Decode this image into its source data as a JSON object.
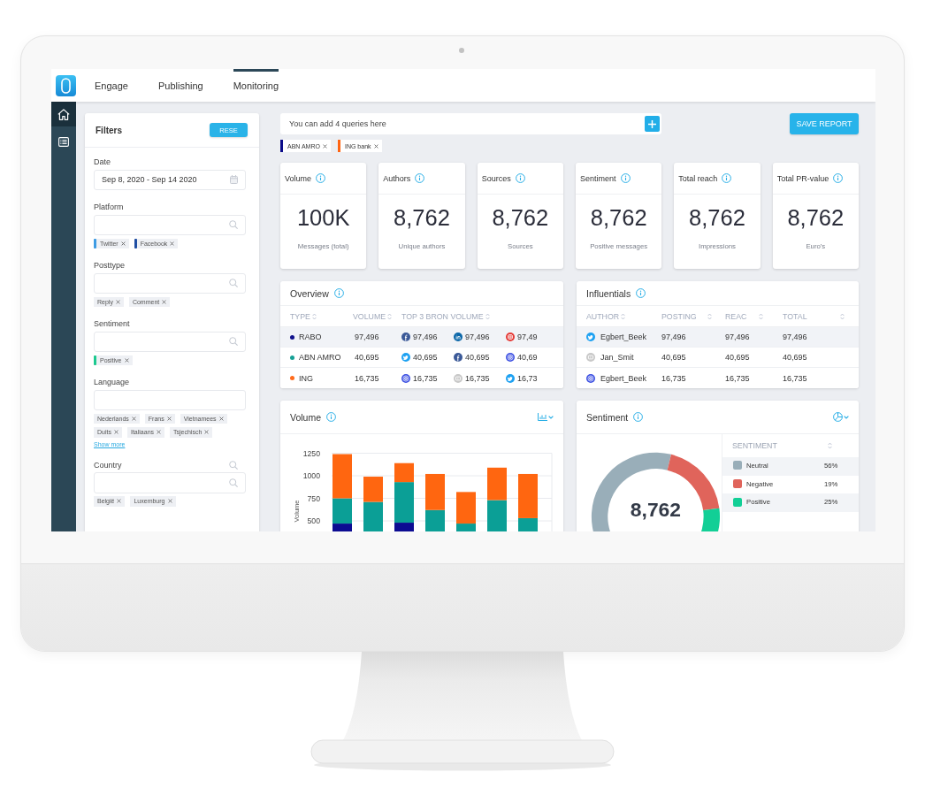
{
  "nav": {
    "tabs": [
      {
        "label": "Engage",
        "selected": false
      },
      {
        "label": "Publishing",
        "selected": false
      },
      {
        "label": "Monitoring",
        "selected": true
      }
    ]
  },
  "sidebar": {
    "items": [
      {
        "kind": "home",
        "selected": true
      },
      {
        "kind": "list",
        "selected": false
      }
    ]
  },
  "filters": {
    "title": "Filters",
    "reset_button": "RESE",
    "groups": [
      {
        "label": "Date",
        "field": {
          "kind": "date",
          "value": "Sep 8, 2020 - Sep 14 2020"
        }
      },
      {
        "label": "Platform",
        "field": {
          "kind": "search"
        },
        "tags": [
          {
            "label": "Twitter",
            "color": "#3d9be3"
          },
          {
            "label": "Facebook",
            "color": "#1f4ea3"
          }
        ]
      },
      {
        "label": "Posttype",
        "field": {
          "kind": "search"
        },
        "tags": [
          {
            "label": "Reply"
          },
          {
            "label": "Comment"
          }
        ]
      },
      {
        "label": "Sentiment",
        "field": {
          "kind": "search"
        },
        "tags": [
          {
            "label": "Positive",
            "color": "#1cc98f"
          }
        ]
      },
      {
        "label": "Language",
        "field": {
          "kind": "text"
        },
        "tags": [
          {
            "label": "Nederlands"
          },
          {
            "label": "Frans"
          },
          {
            "label": "Vietnamees"
          },
          {
            "label": "Duits"
          },
          {
            "label": "Italiaans"
          },
          {
            "label": "Tsjechisch"
          }
        ],
        "more_link": "Show more"
      },
      {
        "label": "Country",
        "label_search_icon": true,
        "field": {
          "kind": "search"
        },
        "tags": [
          {
            "label": "België"
          },
          {
            "label": "Luxemburg"
          }
        ]
      }
    ]
  },
  "query_bar": {
    "placeholder": "You can add 4 queries here"
  },
  "save_button": "SAVE REPORT",
  "queries": [
    {
      "label": "ABN AMRO",
      "color": "#0c0c8a"
    },
    {
      "label": "ING bank",
      "color": "#ff6412"
    }
  ],
  "stats": [
    {
      "title": "Volume",
      "value": "100K",
      "caption": "Messages (total)"
    },
    {
      "title": "Authors",
      "value": "8,762",
      "caption": "Unique authors"
    },
    {
      "title": "Sources",
      "value": "8,762",
      "caption": "Sources"
    },
    {
      "title": "Sentiment",
      "value": "8,762",
      "caption": "Positive messages"
    },
    {
      "title": "Total reach",
      "value": "8,762",
      "caption": "Impressions"
    },
    {
      "title": "Total PR-value",
      "value": "8,762",
      "caption": "Euro's"
    }
  ],
  "overview": {
    "title": "Overview",
    "columns": [
      "TYPE",
      "VOLUME",
      "TOP 3 BRON VOLUME"
    ],
    "rows": [
      {
        "name": "RABO",
        "color": "#11128c",
        "volume": "97,496",
        "selected": true,
        "sources": [
          {
            "kind": "facebook",
            "value": "97,496"
          },
          {
            "kind": "linkedin",
            "value": "97,496"
          },
          {
            "kind": "camera",
            "value": "97,49"
          }
        ]
      },
      {
        "name": "ABN AMRO",
        "color": "#16a095",
        "volume": "40,695",
        "selected": false,
        "sources": [
          {
            "kind": "twitter",
            "value": "40,695"
          },
          {
            "kind": "facebook",
            "value": "40,695"
          },
          {
            "kind": "rings",
            "value": "40,69"
          }
        ]
      },
      {
        "name": "ING",
        "color": "#ff6b1c",
        "volume": "16,735",
        "selected": false,
        "sources": [
          {
            "kind": "rings",
            "value": "16,735"
          },
          {
            "kind": "video",
            "value": "16,735"
          },
          {
            "kind": "twitter",
            "value": "16,73"
          }
        ]
      }
    ]
  },
  "influentials": {
    "title": "Influentials",
    "columns": [
      "AUTHOR",
      "POSTING",
      "REAC",
      "TOTAL"
    ],
    "rows": [
      {
        "kind": "twitter",
        "author": "Egbert_Beek",
        "posting": "97,496",
        "reac": "97,496",
        "total": "97,496",
        "selected": true
      },
      {
        "kind": "video",
        "author": "Jan_Smit",
        "posting": "40,695",
        "reac": "40,695",
        "total": "40,695",
        "selected": false
      },
      {
        "kind": "rings",
        "author": "Egbert_Beek",
        "posting": "16,735",
        "reac": "16,735",
        "total": "16,735",
        "selected": false
      }
    ]
  },
  "volume": {
    "title": "Volume",
    "chart_data": {
      "type": "bar",
      "stacked": true,
      "grid": true,
      "ylabel": "Volume",
      "ylim": [
        0,
        1250
      ],
      "yticks": [
        500,
        750,
        1000,
        1250
      ],
      "series": [
        {
          "color": "#0c0c92",
          "values": [
            470,
            null,
            480,
            null,
            null,
            null,
            null
          ]
        },
        {
          "color": "#0b9f96",
          "values": [
            280,
            710,
            450,
            620,
            470,
            730,
            530
          ]
        },
        {
          "color": "#ff6610",
          "values": [
            490,
            280,
            210,
            400,
            350,
            360,
            490
          ]
        }
      ]
    }
  },
  "sentiment": {
    "title": "Sentiment",
    "center_value": "8,762",
    "legend_heading": "SENTIMENT",
    "legend": [
      {
        "label": "Neutral",
        "value": "56%",
        "color": "#99aeb9"
      },
      {
        "label": "Negative",
        "value": "19%",
        "color": "#e0645b"
      },
      {
        "label": "Positive",
        "value": "25%",
        "color": "#12cf96"
      }
    ],
    "chart_data": {
      "type": "donut",
      "values": [
        56,
        19,
        25
      ]
    }
  }
}
